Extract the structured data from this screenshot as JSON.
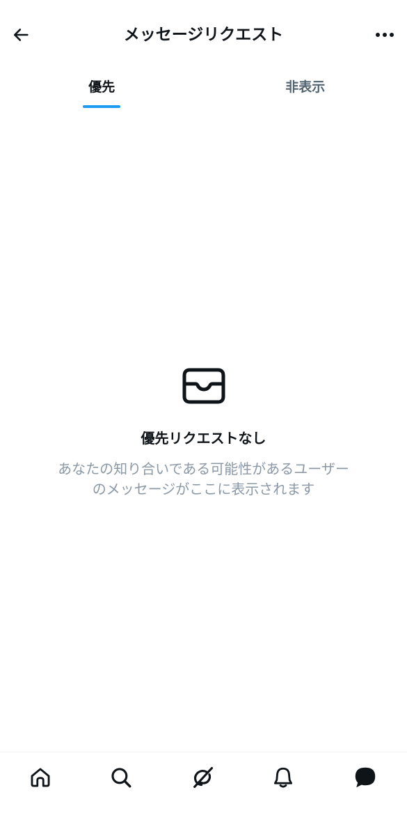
{
  "header": {
    "title": "メッセージリクエスト",
    "back_icon": "arrow-left-icon",
    "more_icon": "more-horizontal-icon"
  },
  "tabs": [
    {
      "label": "優先",
      "active": true
    },
    {
      "label": "非表示",
      "active": false
    }
  ],
  "empty_state": {
    "icon": "inbox-tray-icon",
    "title": "優先リクエストなし",
    "description_line1": "あなたの知り合いである可能性があるユーザー",
    "description_line2": "のメッセージがここに表示されます"
  },
  "bottom_nav": {
    "items": [
      {
        "icon": "home-icon"
      },
      {
        "icon": "search-icon"
      },
      {
        "icon": "grok-icon"
      },
      {
        "icon": "notifications-bell-icon"
      },
      {
        "icon": "messages-icon",
        "active": true
      }
    ]
  },
  "colors": {
    "accent": "#1d9bf0",
    "text_primary": "#0f1419",
    "text_secondary": "#536471",
    "text_muted": "#8b98a5"
  }
}
